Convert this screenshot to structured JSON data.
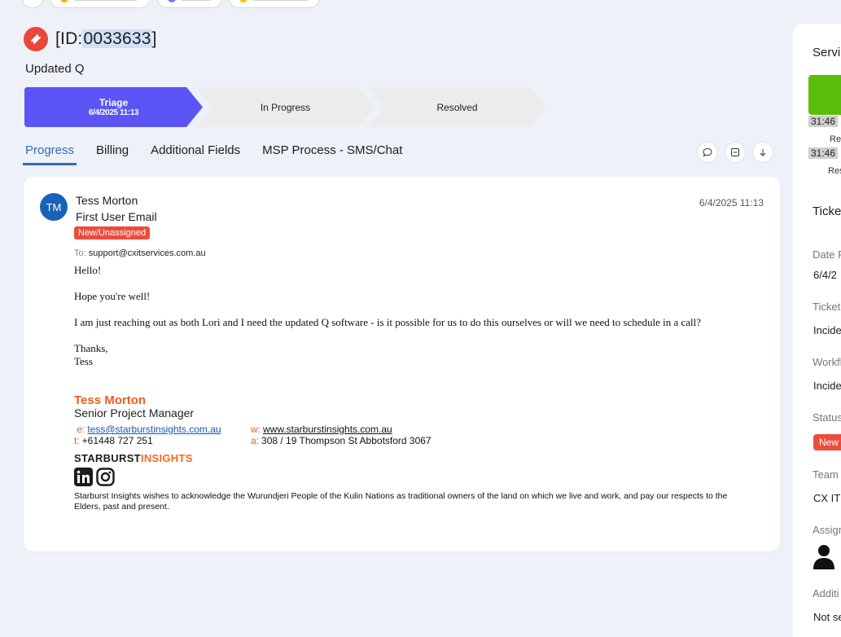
{
  "ticket": {
    "id_prefix": "[ID:",
    "id_number": "0033633",
    "id_suffix": "]",
    "subject": "Updated Q"
  },
  "stages": [
    {
      "label": "Triage",
      "date": "6/4/2025 11:13",
      "active": true
    },
    {
      "label": "In Progress",
      "date": "",
      "active": false
    },
    {
      "label": "Resolved",
      "date": "",
      "active": false
    }
  ],
  "tabs": [
    {
      "label": "Progress",
      "active": true
    },
    {
      "label": "Billing",
      "active": false
    },
    {
      "label": "Additional Fields",
      "active": false
    },
    {
      "label": "MSP Process - SMS/Chat",
      "active": false
    }
  ],
  "message": {
    "avatar_initials": "TM",
    "sender": "Tess Morton",
    "title": "First User Email",
    "status": "New/Unassigned",
    "time": "6/4/2025 11:13",
    "to_label": "To:",
    "to_value": "support@cxitservices.com.au",
    "body": [
      "Hello!",
      "Hope you're well!",
      "I am just reaching out as both Lori and I need the updated Q software - is it possible for us to do this ourselves or will we need to schedule in a call?",
      "Thanks,",
      "Tess"
    ],
    "signature": {
      "name": "Tess Morton",
      "role": "Senior Project Manager",
      "email_key": "e:",
      "email": "tess@starburstinsights.com.au",
      "web_key": "w:",
      "web": "www.starburstinsights.com.au",
      "phone_key": "t:",
      "phone": "+61448 727 251",
      "address_key": "a:",
      "address": "308 / 19 Thompson St Abbotsford 3067",
      "brand_first": "STARBURST",
      "brand_second": "INSIGHTS",
      "acknowledgement": "Starburst Insights wishes to acknowledge the Wurundjeri People of the Kulin Nations as traditional owners of the land on which we live and work, and pay our respects to the Elders, past and present."
    }
  },
  "side": {
    "section1_title": "Servi",
    "sla_time1": "31:46",
    "sla_sub1": "Re",
    "sla_time2": "31:46",
    "sla_sub2": "Res",
    "section2_title": "Ticke",
    "field_date_label": "Date R",
    "field_date_value": "6/4/2",
    "field_ticket_label": "Ticket",
    "field_ticket_value": "Incide",
    "field_workflow_label": "Workfl",
    "field_workflow_value": "Incide",
    "field_status_label": "Status",
    "field_status_value": "New",
    "field_team_label": "Team",
    "field_team_value": "CX IT -",
    "field_assign_label": "Assign",
    "field_additional_label": "Additi",
    "field_additional_value": "Not se"
  },
  "colors": {
    "accent": "#2f6eb2",
    "stage_active": "#5b55f5",
    "stage_inactive": "#ececec",
    "status_red": "#ec4c3c",
    "sla_green": "#5cbc0c",
    "signature_orange": "#e8601c"
  },
  "icons": {
    "ticket_badge": "ticket-icon",
    "comment": "comment-icon",
    "collapse": "collapse-icon",
    "sort_down": "arrow-down-icon",
    "linkedin": "linkedin-icon",
    "instagram": "instagram-icon",
    "assignee": "user-icon"
  }
}
